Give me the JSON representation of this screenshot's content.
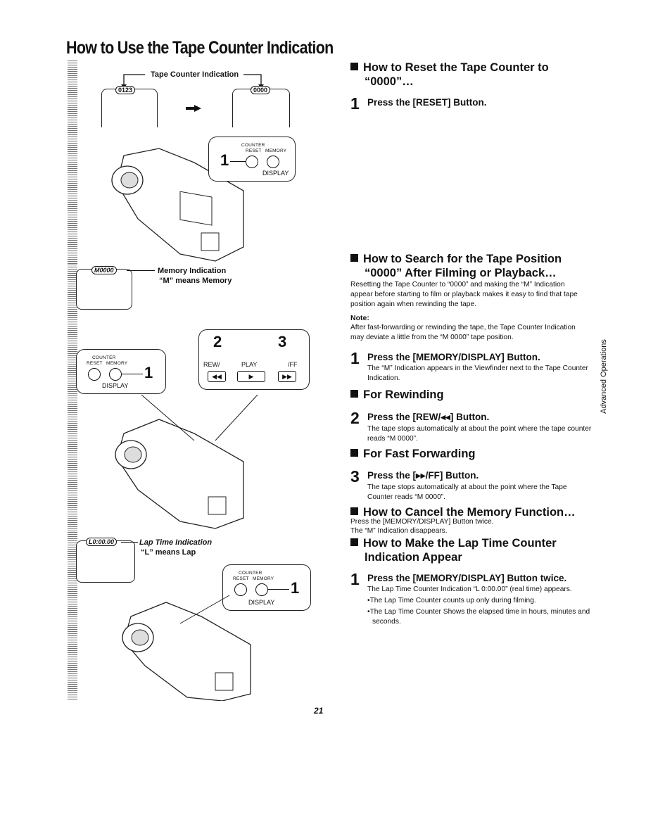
{
  "page": {
    "title": "How to Use the Tape Counter Indication",
    "side_tab": "Advanced Operations",
    "page_number": "21"
  },
  "diagram": {
    "tape_counter_label": "Tape Counter Indication",
    "counter_before": "0123",
    "counter_after": "0000",
    "memory_counter": "M0000",
    "memory_label": "Memory Indication",
    "memory_meaning": "“M” means Memory",
    "lap_counter": "L0:00.00",
    "lap_label": "Lap Time Indication",
    "lap_meaning": "“L” means Lap",
    "counter_caption": "COUNTER",
    "reset_caption": "RESET",
    "memory_caption": "MEMORY",
    "display_caption": "DISPLAY",
    "rew_caption": "REW/",
    "play_caption": "PLAY",
    "ff_caption": "/FF",
    "callouts": [
      "1",
      "1",
      "2",
      "3",
      "1"
    ]
  },
  "sections": {
    "reset": {
      "heading_line1": "How to Reset the Tape Counter to",
      "heading_line2": "“0000”…",
      "step_num": "1",
      "step_title": "Press the [RESET] Button."
    },
    "search": {
      "heading_line1": "How to Search for the Tape Position",
      "heading_line2": "“0000” After Filming or Playback…",
      "intro": "Resetting the Tape Counter to “0000” and making the “M” Indication appear before starting to film or playback makes it easy to find that tape position again when rewinding the tape.",
      "note_label": "Note:",
      "note": "After fast-forwarding or rewinding the tape, the Tape Counter Indication may deviate a little from the “M 0000” tape position.",
      "step1_num": "1",
      "step1_title": "Press the [MEMORY/DISPLAY] Button.",
      "step1_body": "The “M” Indication appears in the Viewfinder next to the Tape Counter Indication."
    },
    "rewind": {
      "heading": "For Rewinding",
      "step_num": "2",
      "step_title": "Press the [REW/◂◂] Button.",
      "step_body": "The tape stops automatically at about the point where the tape counter reads “M 0000”."
    },
    "ff": {
      "heading": "For Fast Forwarding",
      "step_num": "3",
      "step_title": "Press the [▸▸/FF] Button.",
      "step_body": "The tape stops automatically at about the point where the Tape Counter reads “M 0000”."
    },
    "cancel": {
      "heading": "How to Cancel the Memory Function…",
      "line1": "Press the [MEMORY/DISPLAY] Button twice.",
      "line2": "The “M” Indication disappears."
    },
    "lap": {
      "heading_line1": "How to Make the Lap Time Counter",
      "heading_line2": "Indication Appear",
      "step_num": "1",
      "step_title": "Press the [MEMORY/DISPLAY] Button twice.",
      "step_body": "The Lap Time Counter Indication “L 0:00.00” (real time) appears.",
      "bullets": [
        "The Lap Time Counter counts up only during filming.",
        "The Lap Time Counter Shows the elapsed time in hours, minutes and seconds."
      ]
    }
  }
}
